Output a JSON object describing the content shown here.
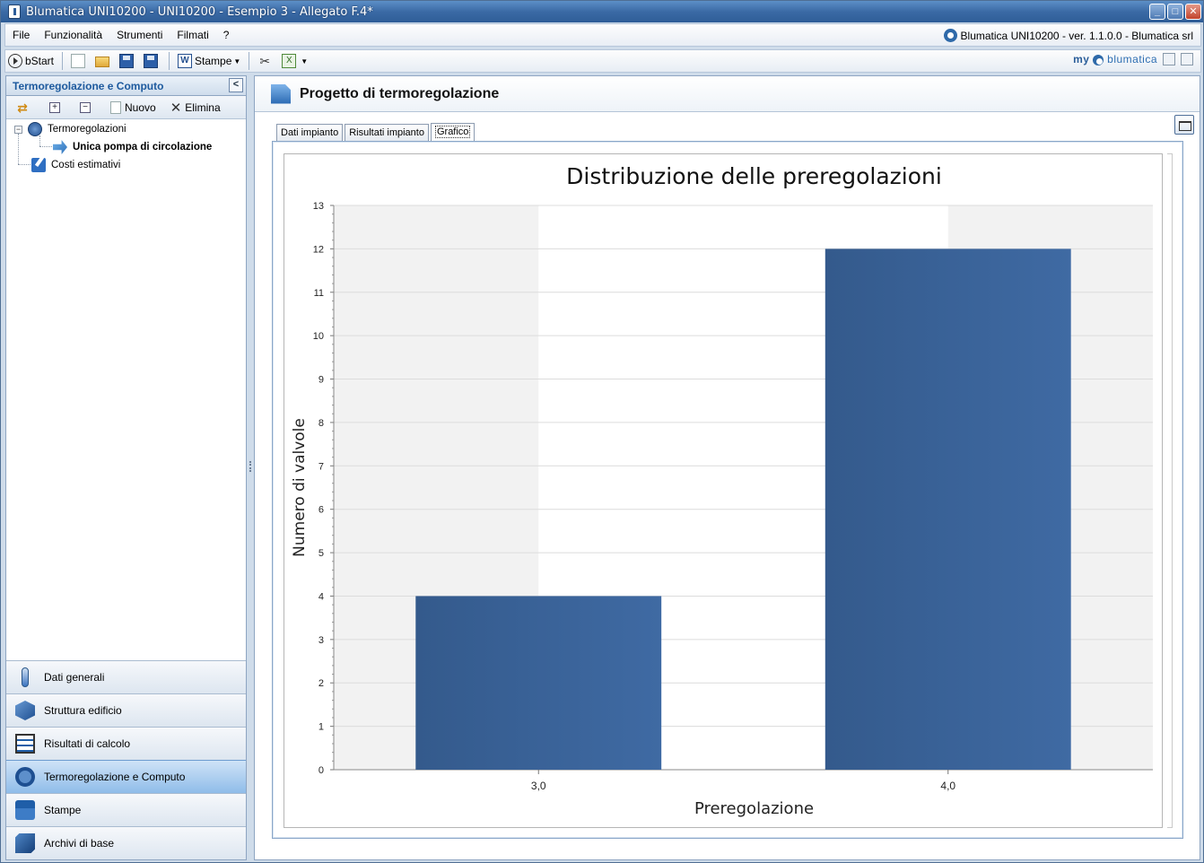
{
  "window": {
    "title": "Blumatica UNI10200 - UNI10200 - Esempio 3 - Allegato F.4*"
  },
  "menu": {
    "items": [
      "File",
      "Funzionalità",
      "Strumenti",
      "Filmati",
      "?"
    ],
    "version_text": "Blumatica UNI10200 - ver. 1.1.0.0 - Blumatica srl"
  },
  "toolbar": {
    "bstart": "bStart",
    "stampe": "Stampe",
    "brand_my": "my",
    "brand_name": "blumatica"
  },
  "left_panel": {
    "title": "Termoregolazione e Computo",
    "tools": {
      "nuovo": "Nuovo",
      "elimina": "Elimina"
    },
    "tree": [
      {
        "label": "Termoregolazioni"
      },
      {
        "label": "Unica pompa di circolazione"
      },
      {
        "label": "Costi estimativi"
      }
    ],
    "nav": [
      {
        "label": "Dati generali"
      },
      {
        "label": "Struttura edificio"
      },
      {
        "label": "Risultati di calcolo"
      },
      {
        "label": "Termoregolazione e Computo"
      },
      {
        "label": "Stampe"
      },
      {
        "label": "Archivi di base"
      }
    ]
  },
  "right_panel": {
    "title": "Progetto di termoregolazione",
    "tabs": [
      "Dati impianto",
      "Risultati impianto",
      "Grafico"
    ],
    "selected_tab": "Grafico"
  },
  "colors": {
    "bar": "#3f6aa3",
    "band": "#f2f2f2",
    "grid": "#dcdcdc"
  },
  "chart_data": {
    "type": "bar",
    "title": "Distribuzione delle preregolazioni",
    "xlabel": "Preregolazione",
    "ylabel": "Numero di valvole",
    "categories": [
      "3,0",
      "4,0"
    ],
    "values": [
      4,
      12
    ],
    "ylim": [
      0,
      13
    ],
    "yticks": [
      0,
      1,
      2,
      3,
      4,
      5,
      6,
      7,
      8,
      9,
      10,
      11,
      12,
      13
    ],
    "grid": true
  }
}
